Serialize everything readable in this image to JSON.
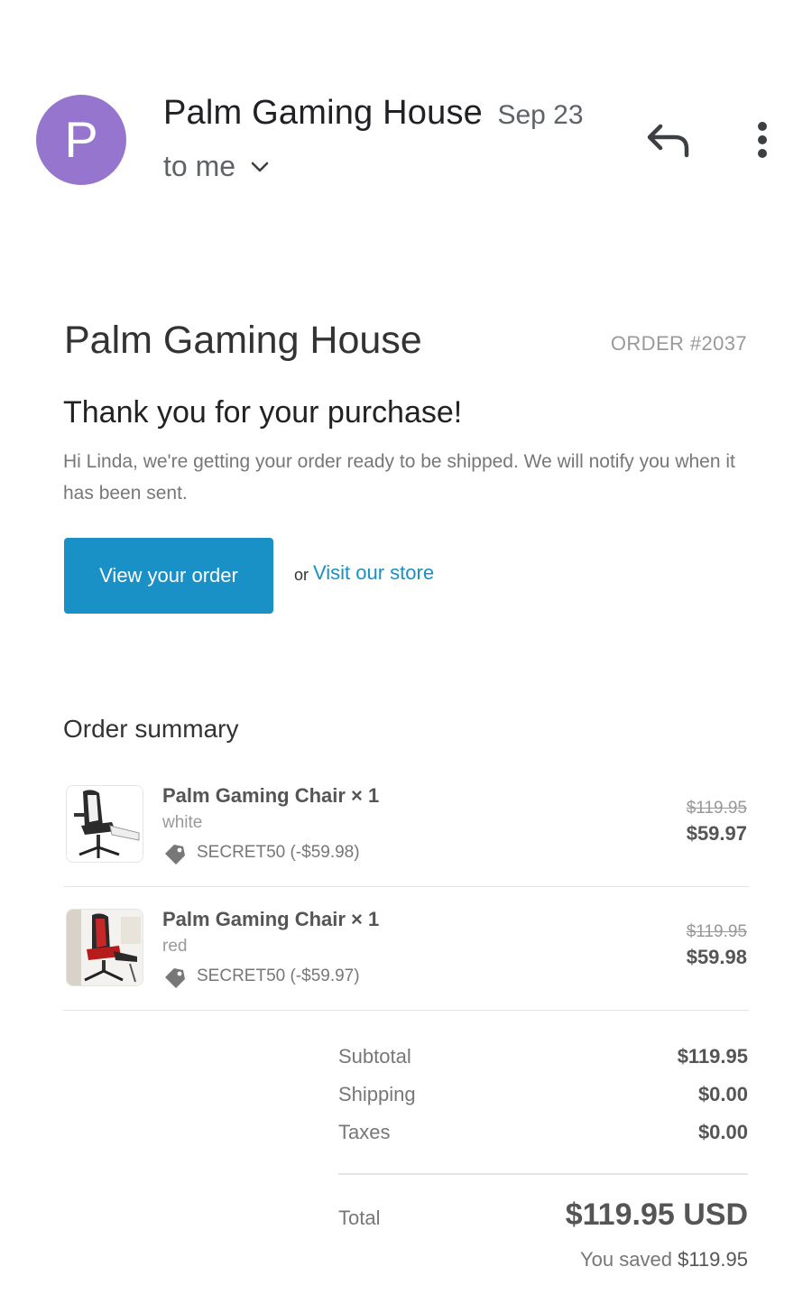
{
  "email": {
    "avatar_letter": "P",
    "avatar_color": "#9575cd",
    "sender": "Palm Gaming House",
    "date": "Sep 23",
    "recipient": "to me",
    "icons": [
      "chevron-down-icon",
      "reply-icon",
      "more-vert-icon"
    ]
  },
  "body": {
    "store_name": "Palm Gaming House",
    "order_number": "ORDER #2037",
    "heading": "Thank you for your purchase!",
    "message": "Hi Linda, we're getting your order ready to be shipped. We will notify you when it has been sent.",
    "view_order_label": "View your order",
    "or_text": "or",
    "visit_store_label": "Visit our store",
    "accent_color": "#1990c6"
  },
  "summary": {
    "heading": "Order summary",
    "items": [
      {
        "title": "Palm Gaming Chair × 1",
        "variant": "white",
        "discount": "SECRET50 (-$59.98)",
        "original_price": "$119.95",
        "final_price": "$59.97",
        "thumbnail": "gaming-chair-white-image"
      },
      {
        "title": "Palm Gaming Chair × 1",
        "variant": "red",
        "discount": "SECRET50 (-$59.97)",
        "original_price": "$119.95",
        "final_price": "$59.98",
        "thumbnail": "gaming-chair-red-image"
      }
    ],
    "subtotal_label": "Subtotal",
    "subtotal_value": "$119.95",
    "shipping_label": "Shipping",
    "shipping_value": "$0.00",
    "taxes_label": "Taxes",
    "taxes_value": "$0.00",
    "total_label": "Total",
    "total_value": "$119.95 USD",
    "saved_prefix": "You saved ",
    "saved_amount": "$119.95"
  }
}
